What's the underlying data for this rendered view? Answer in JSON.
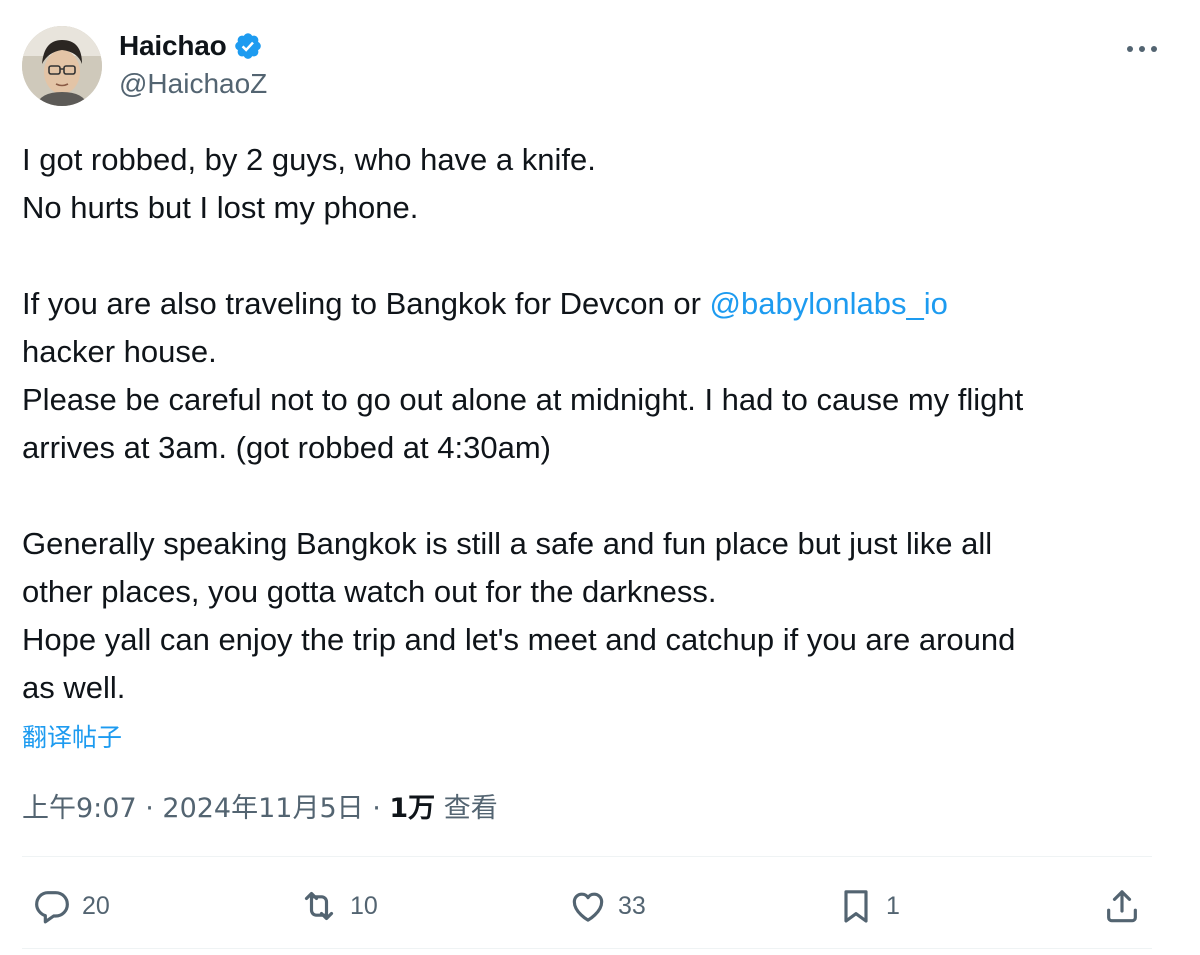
{
  "author": {
    "display_name": "Haichao",
    "handle": "@HaichaoZ",
    "verified": true,
    "verified_color": "#1d9bf0"
  },
  "tweet": {
    "line1": "I got robbed, by 2 guys, who have a knife.",
    "line2": "No hurts but I lost my phone.",
    "line3_before": "If you are also traveling to Bangkok for Devcon or ",
    "mention": "@babylonlabs_io",
    "line4": "hacker house.",
    "line5": "Please be careful not to go out alone at midnight. I had to cause my flight",
    "line6": "arrives at 3am. (got robbed at 4:30am)",
    "line7": "Generally speaking Bangkok is still a safe and fun place but just like all",
    "line8": "other places, you gotta watch out for the darkness.",
    "line9": "Hope yall can enjoy the trip and let's meet and catchup if you are around",
    "line10": "as well."
  },
  "translate_label": "翻译帖子",
  "meta": {
    "time": "上午9:07",
    "separator": " · ",
    "date": "2024年11月5日",
    "views_count": "1万",
    "views_label": " 查看"
  },
  "actions": {
    "replies": "20",
    "reposts": "10",
    "likes": "33",
    "bookmarks": "1"
  },
  "icons": {
    "more": "more-horizontal-icon",
    "reply": "reply-icon",
    "repost": "repost-icon",
    "like": "heart-icon",
    "bookmark": "bookmark-icon",
    "share": "share-icon",
    "verified": "verified-badge-icon"
  },
  "colors": {
    "text": "#0f1419",
    "secondary": "#536471",
    "accent": "#1d9bf0"
  }
}
